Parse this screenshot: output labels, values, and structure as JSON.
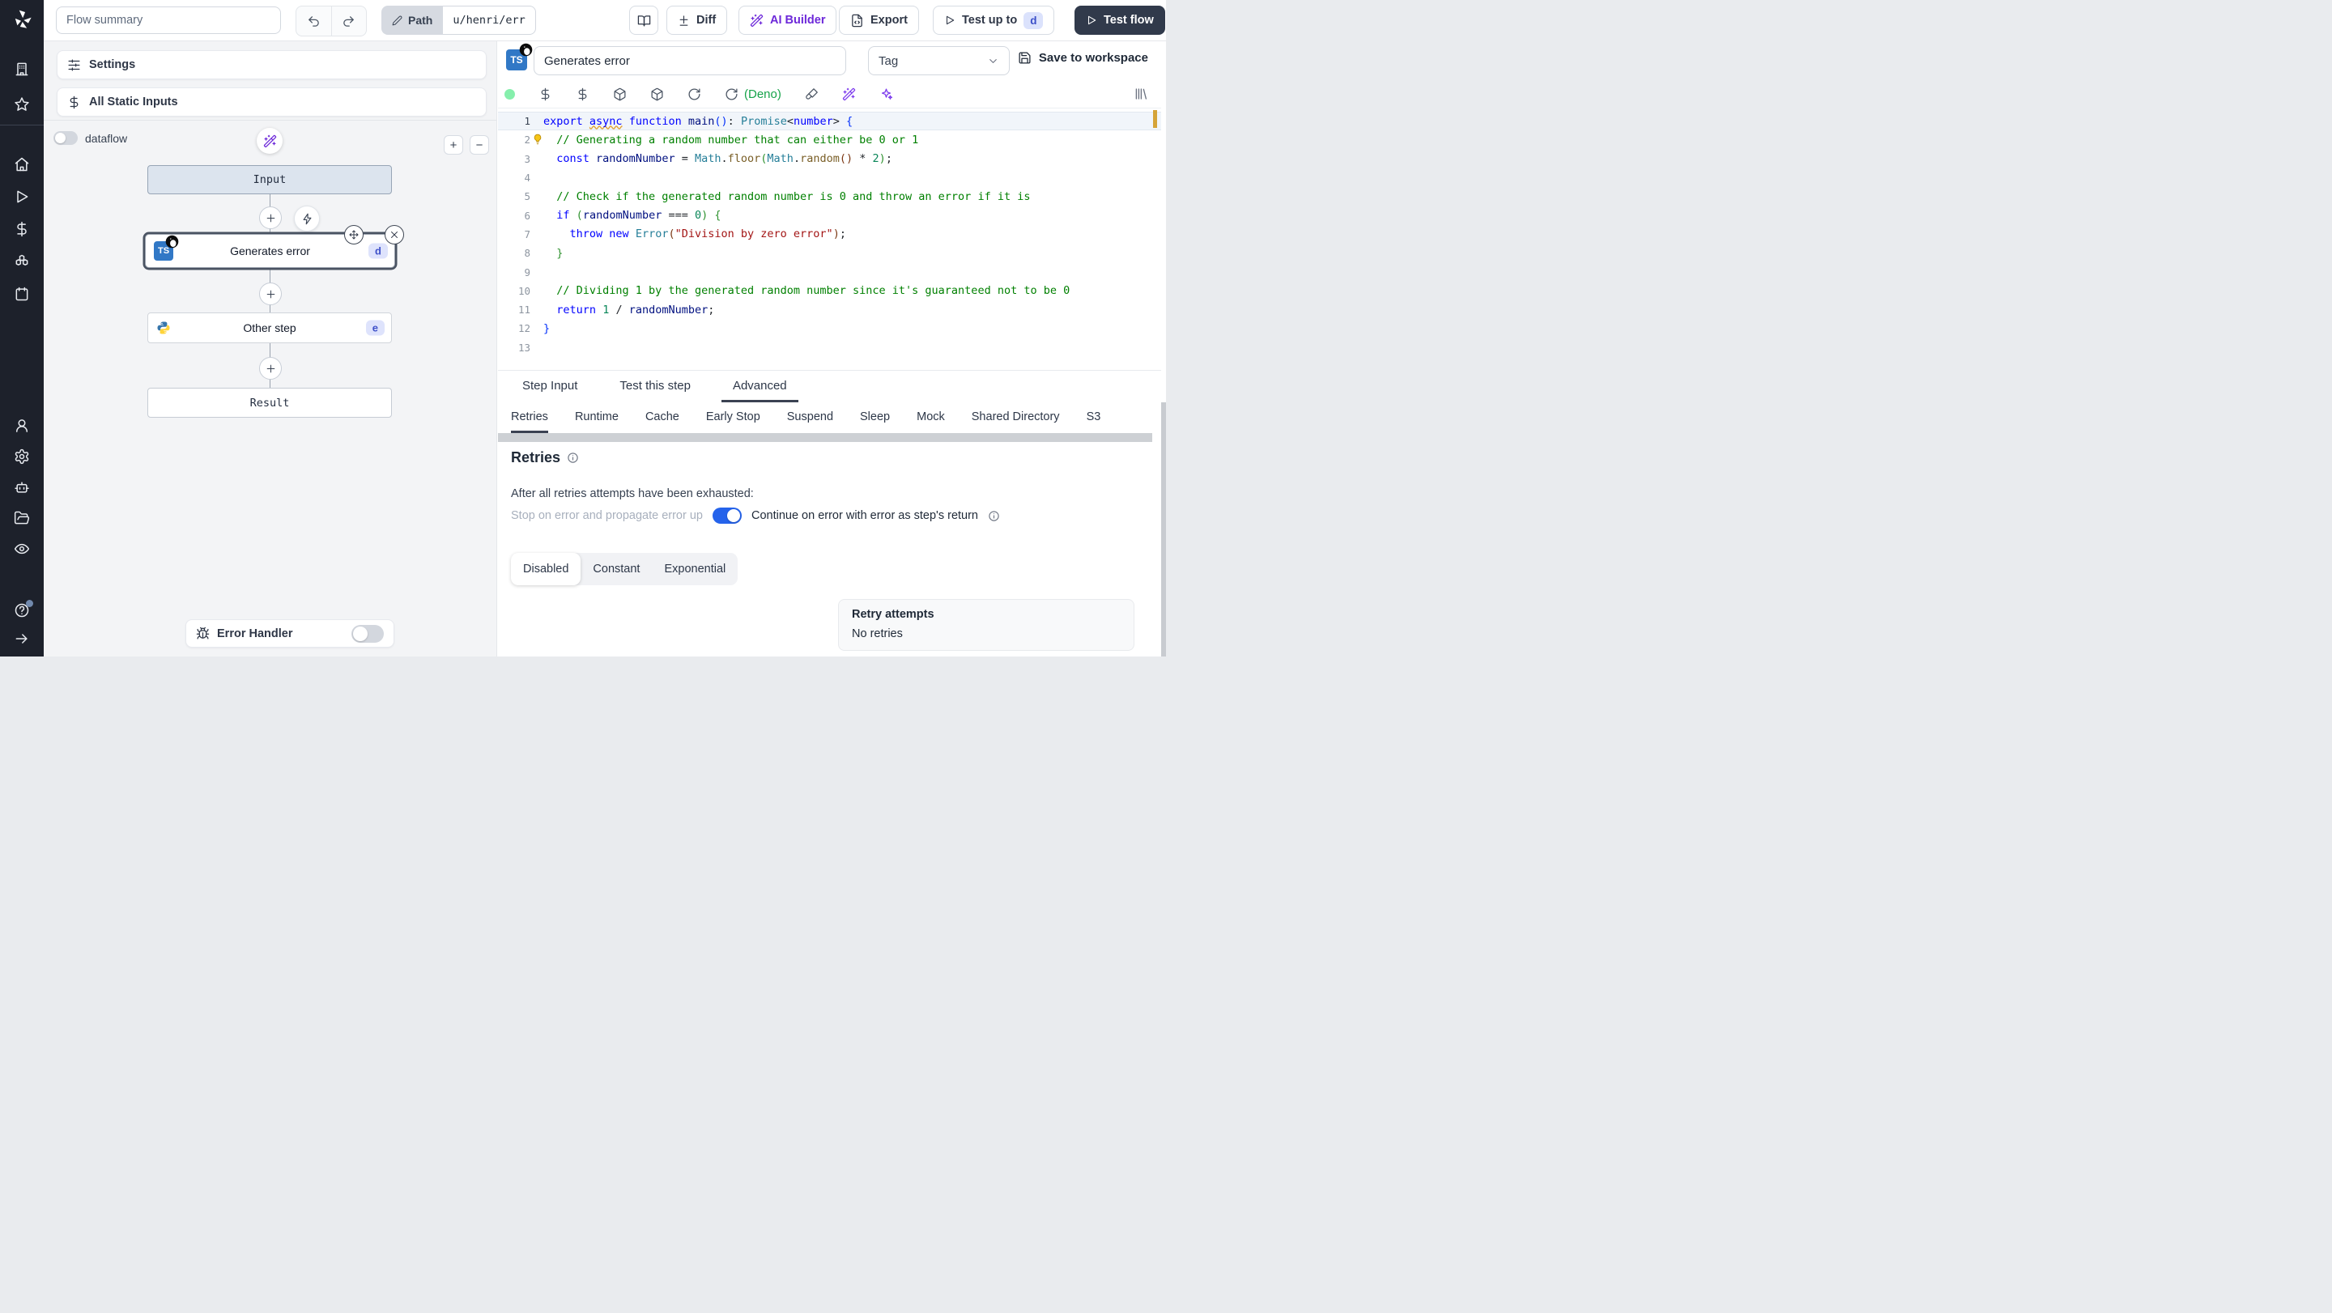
{
  "topbar": {
    "flow_summary_placeholder": "Flow summary",
    "path_label": "Path",
    "path_value": "u/henri/err",
    "diff_label": "Diff",
    "ai_builder_label": "AI Builder",
    "export_label": "Export",
    "test_up_to_label": "Test up to",
    "test_up_to_step": "d",
    "test_flow_label": "Test flow"
  },
  "sidebar": {
    "groups": [
      [
        "building",
        "star"
      ],
      [
        "home",
        "play",
        "dollar",
        "boxes",
        "calendar"
      ],
      [
        "user",
        "gear",
        "bot",
        "folder-open",
        "eye"
      ]
    ],
    "bottom": [
      "help-circle",
      "arrow-right"
    ]
  },
  "flow_panel": {
    "settings_label": "Settings",
    "static_inputs_label": "All Static Inputs",
    "dataflow_label": "dataflow",
    "zoom_in_label": "+",
    "zoom_out_label": "−",
    "input_label": "Input",
    "step1_label": "Generates error",
    "step1_badge": "d",
    "step1_language": "typescript-deno",
    "step2_label": "Other step",
    "step2_badge": "e",
    "step2_language": "python",
    "result_label": "Result",
    "error_handler_label": "Error Handler"
  },
  "step_editor": {
    "name_value": "Generates error",
    "tag_placeholder": "Tag",
    "save_label": "Save to workspace",
    "language_label": "TS",
    "deno_label": "(Deno)",
    "toolbar_icons": [
      "status-dot",
      "dollar",
      "dollar",
      "package",
      "package",
      "rotate-cw",
      "rotate-cw",
      "deno-label",
      "paintbrush",
      "wand",
      "sparkles"
    ],
    "library_icon": "library",
    "code": {
      "lines": [
        {
          "num": 1,
          "current": true,
          "tokens": [
            [
              "k",
              "export"
            ],
            [
              "p",
              " "
            ],
            [
              "k sq",
              "async"
            ],
            [
              "p",
              " "
            ],
            [
              "k",
              "function"
            ],
            [
              "p",
              " "
            ],
            [
              "v",
              "main"
            ],
            [
              "b1",
              "("
            ],
            [
              "b1",
              ")"
            ],
            [
              "p",
              ": "
            ],
            [
              "t",
              "Promise"
            ],
            [
              "p",
              "<"
            ],
            [
              "k",
              "number"
            ],
            [
              "p",
              "> "
            ],
            [
              "b1",
              "{"
            ]
          ]
        },
        {
          "num": 2,
          "bulb": true,
          "tokens": [
            [
              "p",
              "  "
            ],
            [
              "c",
              "// Generating a random number that can either be 0 or 1"
            ]
          ]
        },
        {
          "num": 3,
          "tokens": [
            [
              "p",
              "  "
            ],
            [
              "k",
              "const"
            ],
            [
              "p",
              " "
            ],
            [
              "v",
              "randomNumber"
            ],
            [
              "p",
              " = "
            ],
            [
              "t",
              "Math"
            ],
            [
              "p",
              "."
            ],
            [
              "f",
              "floor"
            ],
            [
              "b2",
              "("
            ],
            [
              "t",
              "Math"
            ],
            [
              "p",
              "."
            ],
            [
              "f",
              "random"
            ],
            [
              "b3",
              "("
            ],
            [
              "b3",
              ")"
            ],
            [
              "p",
              " * "
            ],
            [
              "n",
              "2"
            ],
            [
              "b2",
              ")"
            ],
            [
              "p",
              ";"
            ]
          ]
        },
        {
          "num": 4,
          "tokens": []
        },
        {
          "num": 5,
          "tokens": [
            [
              "p",
              "  "
            ],
            [
              "c",
              "// Check if the generated random number is 0 and throw an error if it is"
            ]
          ]
        },
        {
          "num": 6,
          "tokens": [
            [
              "p",
              "  "
            ],
            [
              "k",
              "if"
            ],
            [
              "p",
              " "
            ],
            [
              "b2",
              "("
            ],
            [
              "v",
              "randomNumber"
            ],
            [
              "p",
              " === "
            ],
            [
              "n",
              "0"
            ],
            [
              "b2",
              ")"
            ],
            [
              "p",
              " "
            ],
            [
              "b2",
              "{"
            ]
          ]
        },
        {
          "num": 7,
          "tokens": [
            [
              "p",
              "    "
            ],
            [
              "k",
              "throw"
            ],
            [
              "p",
              " "
            ],
            [
              "k",
              "new"
            ],
            [
              "p",
              " "
            ],
            [
              "t",
              "Error"
            ],
            [
              "b3",
              "("
            ],
            [
              "s",
              "\"Division by zero error\""
            ],
            [
              "b3",
              ")"
            ],
            [
              "p",
              ";"
            ]
          ]
        },
        {
          "num": 8,
          "tokens": [
            [
              "p",
              "  "
            ],
            [
              "b2",
              "}"
            ]
          ]
        },
        {
          "num": 9,
          "tokens": []
        },
        {
          "num": 10,
          "tokens": [
            [
              "p",
              "  "
            ],
            [
              "c",
              "// Dividing 1 by the generated random number since it's guaranteed not to be 0"
            ]
          ]
        },
        {
          "num": 11,
          "tokens": [
            [
              "p",
              "  "
            ],
            [
              "k",
              "return"
            ],
            [
              "p",
              " "
            ],
            [
              "n",
              "1"
            ],
            [
              "p",
              " / "
            ],
            [
              "v",
              "randomNumber"
            ],
            [
              "p",
              ";"
            ]
          ]
        },
        {
          "num": 12,
          "tokens": [
            [
              "b1",
              "}"
            ]
          ]
        },
        {
          "num": 13,
          "tokens": []
        }
      ]
    }
  },
  "tabs": {
    "items": [
      "Step Input",
      "Test this step",
      "Advanced"
    ],
    "active": "Advanced"
  },
  "subtabs": {
    "items": [
      "Retries",
      "Runtime",
      "Cache",
      "Early Stop",
      "Suspend",
      "Sleep",
      "Mock",
      "Shared Directory",
      "S3"
    ],
    "active": "Retries"
  },
  "retries": {
    "title": "Retries",
    "description": "After all retries attempts have been exhausted:",
    "toggle_off_label": "Stop on error and propagate error up",
    "toggle_on_label": "Continue on error with error as step's return",
    "toggle_state": true,
    "modes": [
      "Disabled",
      "Constant",
      "Exponential"
    ],
    "active_mode": "Disabled",
    "card_title": "Retry attempts",
    "card_value": "No retries"
  },
  "colors": {
    "accent_blue": "#2563eb",
    "purple": "#6d28d9",
    "badge_bg": "#dbe2fc",
    "badge_text": "#3b4fc8",
    "deno_green": "#16a34a",
    "status_green": "#86efac",
    "ts_blue": "#3178c6",
    "dark_button": "#313a4b"
  }
}
